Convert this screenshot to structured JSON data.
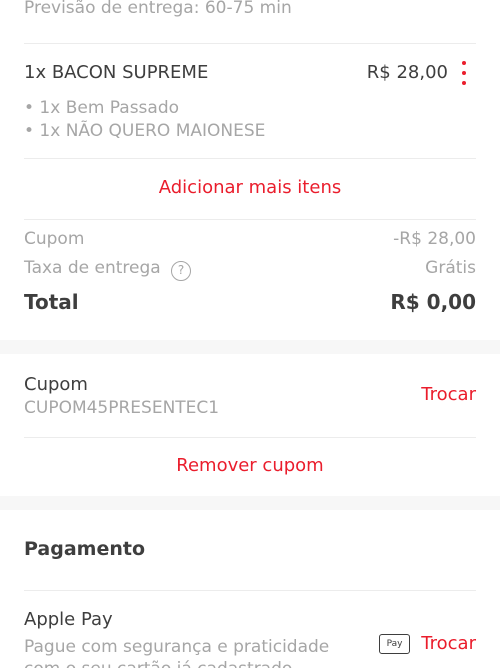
{
  "order": {
    "delivery_estimate": "Previsão de entrega: 60-75 min",
    "item": {
      "name": "1x BACON SUPREME",
      "price": "R$ 28,00",
      "options": [
        "• 1x Bem Passado",
        "• 1x NÃO QUERO MAIONESE"
      ]
    },
    "add_more_label": "Adicionar mais itens"
  },
  "summary": {
    "coupon_label": "Cupom",
    "coupon_value": "-R$ 28,00",
    "delivery_fee_label": "Taxa de entrega",
    "delivery_fee_value": "Grátis",
    "help_glyph": "?",
    "total_label": "Total",
    "total_value": "R$ 0,00"
  },
  "coupon": {
    "title": "Cupom",
    "code": "CUPOM45PRESENTEC1",
    "change_label": "Trocar",
    "remove_label": "Remover cupom"
  },
  "payment": {
    "title": "Pagamento",
    "method": "Apple Pay",
    "description": "Pague com segurança e praticidade com o seu cartão já cadastrado",
    "badge_label": "Pay",
    "change_label": "Trocar"
  },
  "colors": {
    "accent": "#ea1d2c",
    "text": "#3e3e3e",
    "muted": "#a6a6a6",
    "divider": "#ececec",
    "section_bg": "#f7f7f7"
  },
  "icons": {
    "more": "more-vertical-icon",
    "help": "help-circle-icon",
    "apple_pay": "apple-pay-icon"
  }
}
